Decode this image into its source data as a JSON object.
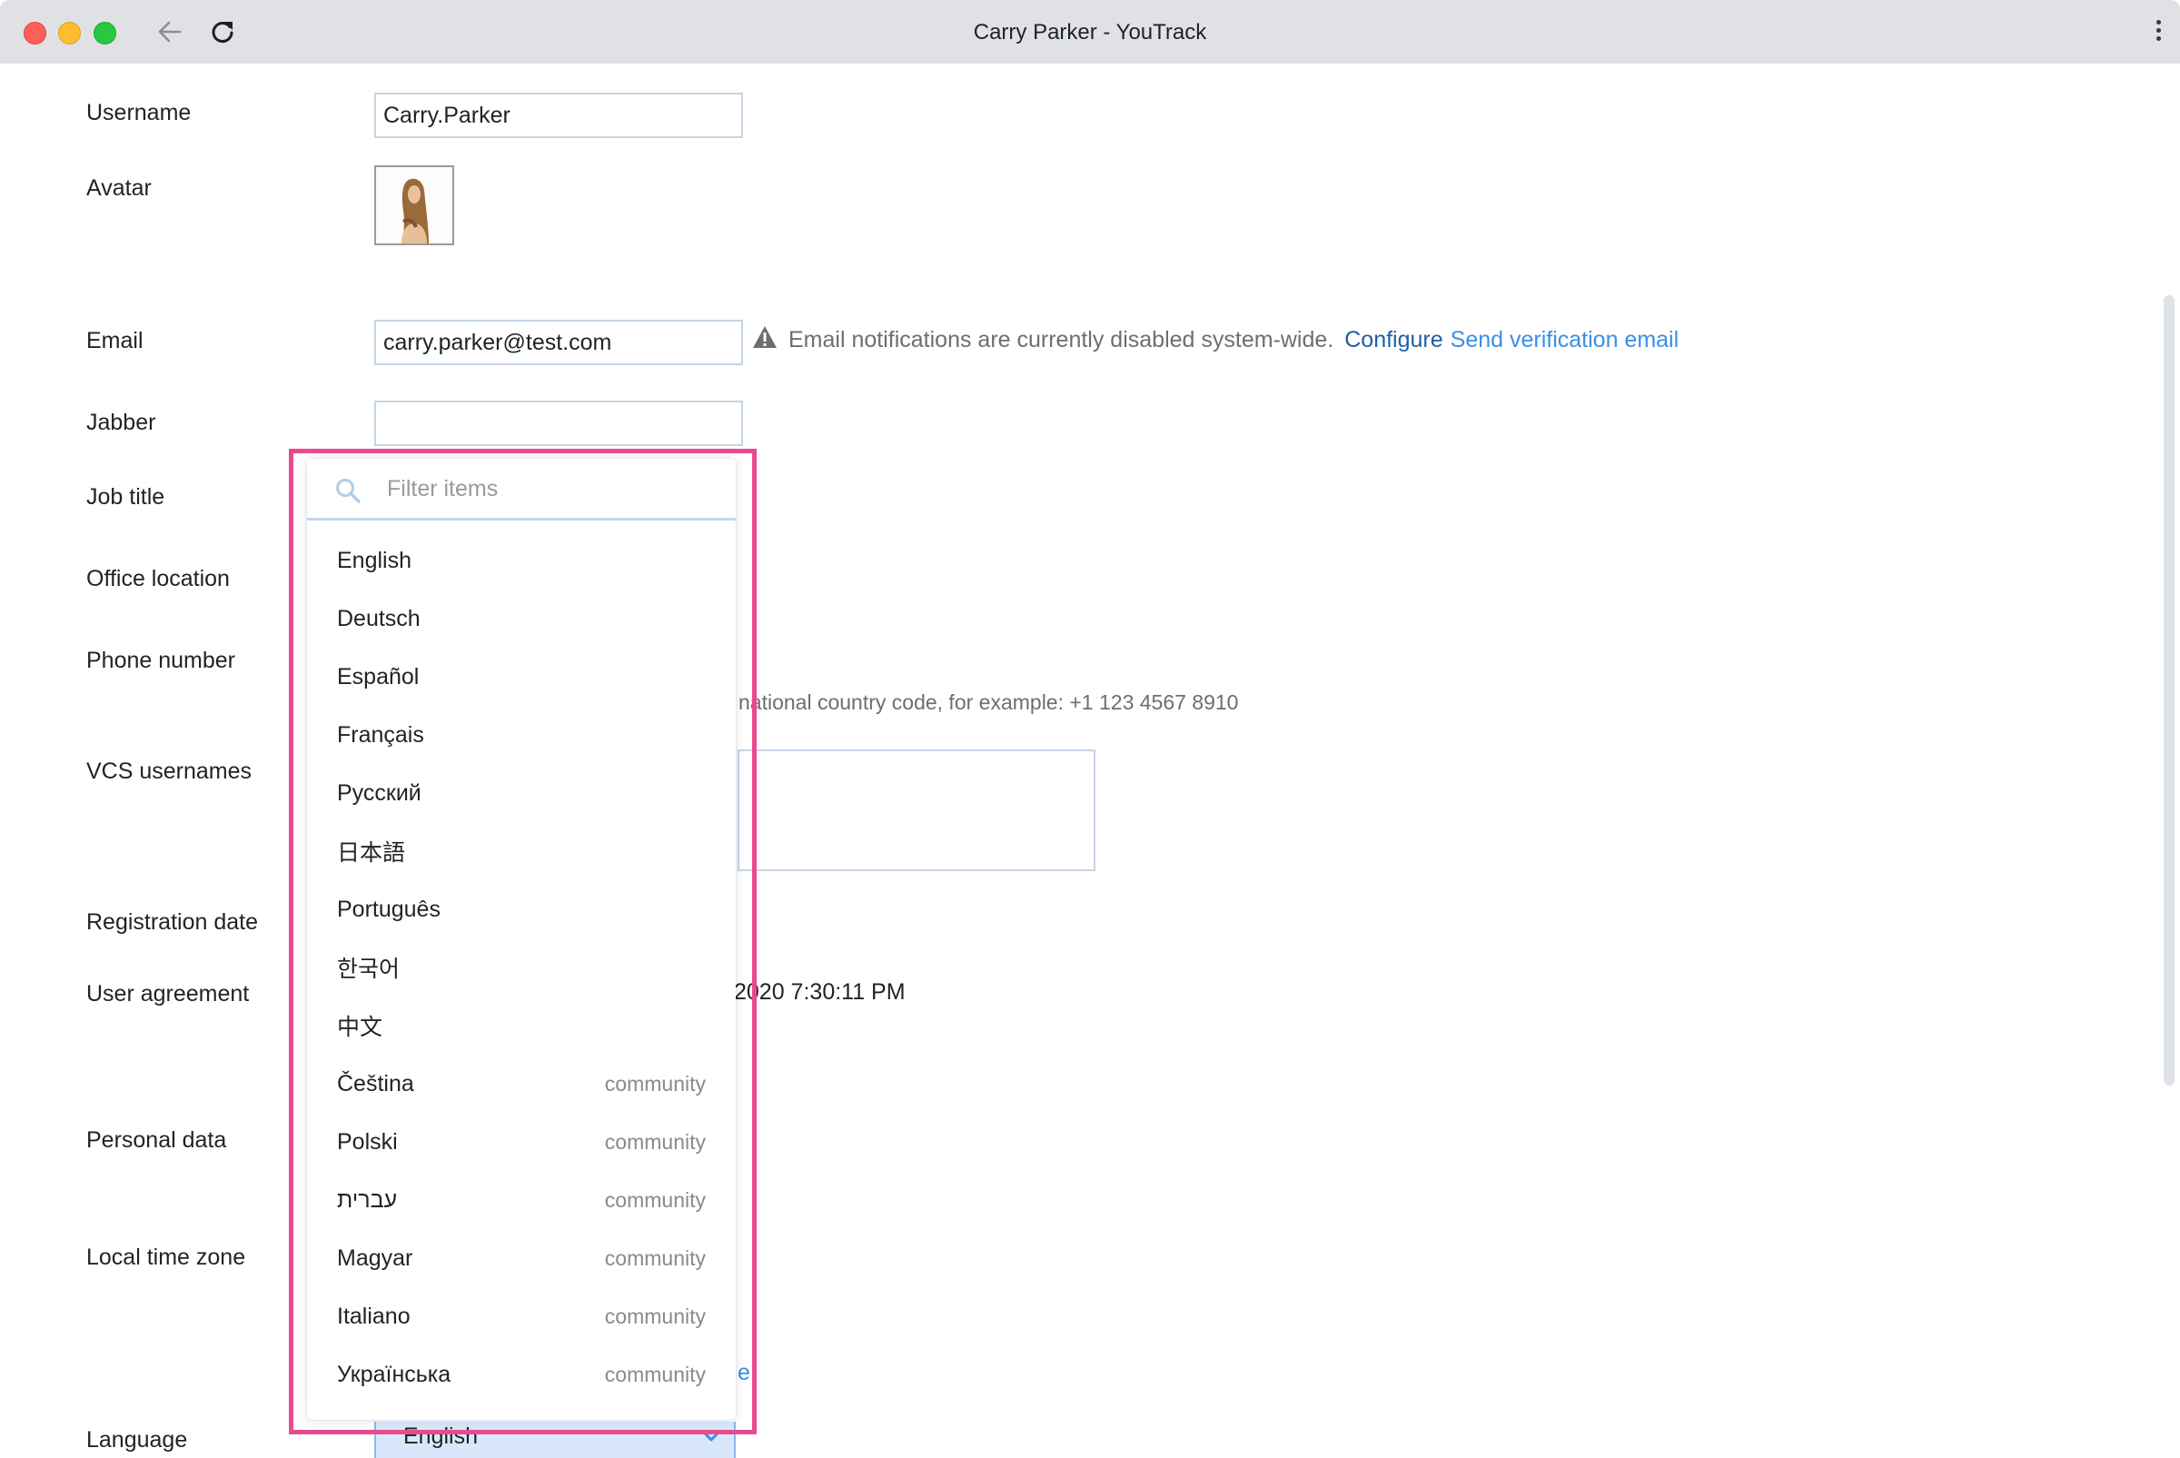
{
  "window": {
    "title": "Carry Parker - YouTrack",
    "icons": [
      "back-arrow-icon",
      "reload-icon",
      "more-vertical-icon"
    ]
  },
  "form": {
    "username": {
      "label": "Username",
      "value": "Carry.Parker"
    },
    "avatar": {
      "label": "Avatar"
    },
    "email": {
      "label": "Email",
      "value": "carry.parker@test.com",
      "notice": "Email notifications are currently disabled system-wide.",
      "configure_link": "Configure",
      "verify_link": "Send verification email"
    },
    "jabber": {
      "label": "Jabber",
      "value": ""
    },
    "job_title": {
      "label": "Job title"
    },
    "office_location": {
      "label": "Office location"
    },
    "phone_number": {
      "label": "Phone number",
      "hint_visible": "national country code, for example: +1 123 4567 8910"
    },
    "vcs_usernames": {
      "label": "VCS usernames"
    },
    "registration_date": {
      "label": "Registration date"
    },
    "user_agreement": {
      "label": "User agreement",
      "value_visible": "2020 7:30:11 PM"
    },
    "personal_data": {
      "label": "Personal data"
    },
    "local_time_zone": {
      "label": "Local time zone",
      "clipped_link_char": "e"
    },
    "language": {
      "label": "Language",
      "selected": "English"
    }
  },
  "dropdown": {
    "filter_placeholder": "Filter items",
    "items": [
      {
        "label": "English",
        "tag": ""
      },
      {
        "label": "Deutsch",
        "tag": ""
      },
      {
        "label": "Español",
        "tag": ""
      },
      {
        "label": "Français",
        "tag": ""
      },
      {
        "label": "Русский",
        "tag": ""
      },
      {
        "label": "日本語",
        "tag": ""
      },
      {
        "label": "Português",
        "tag": ""
      },
      {
        "label": "한국어",
        "tag": ""
      },
      {
        "label": "中文",
        "tag": ""
      },
      {
        "label": "Čeština",
        "tag": "community"
      },
      {
        "label": "Polski",
        "tag": "community"
      },
      {
        "label": "עברית",
        "tag": "community"
      },
      {
        "label": "Magyar",
        "tag": "community"
      },
      {
        "label": "Italiano",
        "tag": "community"
      },
      {
        "label": "Українська",
        "tag": "community"
      }
    ]
  },
  "colors": {
    "highlight": "#e94a8c",
    "link_dark": "#1f5fa6",
    "link_light": "#3a8ee6",
    "input_border": "#c5d5e4",
    "select_bg": "#d8e8fa"
  }
}
